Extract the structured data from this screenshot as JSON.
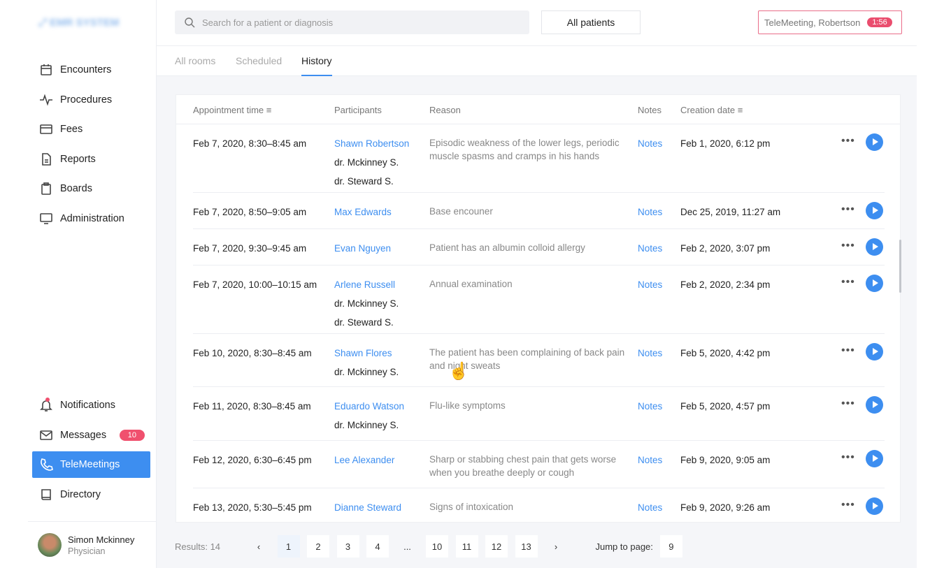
{
  "logo": "EMR SYSTEM",
  "sidebar": {
    "items": [
      {
        "label": "Encounters",
        "icon": "calendar-icon"
      },
      {
        "label": "Procedures",
        "icon": "pulse-icon"
      },
      {
        "label": "Fees",
        "icon": "card-icon"
      },
      {
        "label": "Reports",
        "icon": "document-icon"
      },
      {
        "label": "Boards",
        "icon": "clipboard-icon"
      },
      {
        "label": "Administration",
        "icon": "monitor-icon"
      }
    ],
    "bottom": [
      {
        "label": "Notifications",
        "icon": "bell-icon"
      },
      {
        "label": "Messages",
        "icon": "mail-icon",
        "badge": "10"
      },
      {
        "label": "TeleMeetings",
        "icon": "phone-icon",
        "active": true
      },
      {
        "label": "Directory",
        "icon": "book-icon"
      }
    ],
    "user": {
      "name": "Simon Mckinney",
      "role": "Physician"
    }
  },
  "header": {
    "search_placeholder": "Search for a patient or diagnosis",
    "filter": "All patients",
    "telemeeting": "TeleMeeting, Robertson",
    "timer": "1:56"
  },
  "tabs": [
    "All rooms",
    "Scheduled",
    "History"
  ],
  "table": {
    "headers": [
      "Appointment time",
      "Participants",
      "Reason",
      "Notes",
      "Creation date"
    ],
    "rows": [
      {
        "time": "Feb 7, 2020, 8:30–8:45 am",
        "patient": "Shawn Robertson",
        "docs": [
          "dr. Mckinney S.",
          "dr. Steward S."
        ],
        "reason": "Episodic weakness of the lower legs, periodic muscle spasms and cramps in his hands",
        "notes": "Notes",
        "created": "Feb 1, 2020, 6:12 pm"
      },
      {
        "time": "Feb 7, 2020, 8:50–9:05 am",
        "patient": "Max Edwards",
        "docs": [],
        "reason": "Base encouner",
        "notes": "Notes",
        "created": "Dec 25, 2019, 11:27 am"
      },
      {
        "time": "Feb 7, 2020, 9:30–9:45 am",
        "patient": "Evan Nguyen",
        "docs": [],
        "reason": "Patient has an albumin colloid allergy",
        "notes": "Notes",
        "created": "Feb 2, 2020, 3:07 pm"
      },
      {
        "time": "Feb 7, 2020, 10:00–10:15 am",
        "patient": "Arlene Russell",
        "docs": [
          "dr. Mckinney S.",
          "dr. Steward S."
        ],
        "reason": "Annual examination",
        "notes": "Notes",
        "created": "Feb 2, 2020, 2:34 pm"
      },
      {
        "time": "Feb 10, 2020, 8:30–8:45 am",
        "patient": "Shawn Flores",
        "docs": [
          "dr. Mckinney S."
        ],
        "reason": "The patient has been complaining of back pain and night sweats",
        "notes": "Notes",
        "created": "Feb 5, 2020, 4:42 pm"
      },
      {
        "time": "Feb 11, 2020, 8:30–8:45 am",
        "patient": "Eduardo Watson",
        "docs": [
          "dr. Mckinney S."
        ],
        "reason": "Flu-like symptoms",
        "notes": "Notes",
        "created": "Feb 5, 2020, 4:57 pm"
      },
      {
        "time": "Feb 12, 2020, 6:30–6:45 pm",
        "patient": "Lee Alexander",
        "docs": [],
        "reason": "Sharp or stabbing chest pain that gets worse when you breathe deeply or cough",
        "notes": "Notes",
        "created": "Feb 9, 2020, 9:05 am"
      },
      {
        "time": "Feb 13, 2020, 5:30–5:45 pm",
        "patient": "Dianne Steward",
        "docs": [],
        "reason": "Signs of intoxication",
        "notes": "Notes",
        "created": "Feb 9, 2020, 9:26 am"
      }
    ]
  },
  "pagination": {
    "results": "Results: 14",
    "pages": [
      "1",
      "2",
      "3",
      "4",
      "...",
      "10",
      "11",
      "12",
      "13"
    ],
    "current": "1",
    "jump_label": "Jump to page:",
    "jump_value": "9"
  }
}
